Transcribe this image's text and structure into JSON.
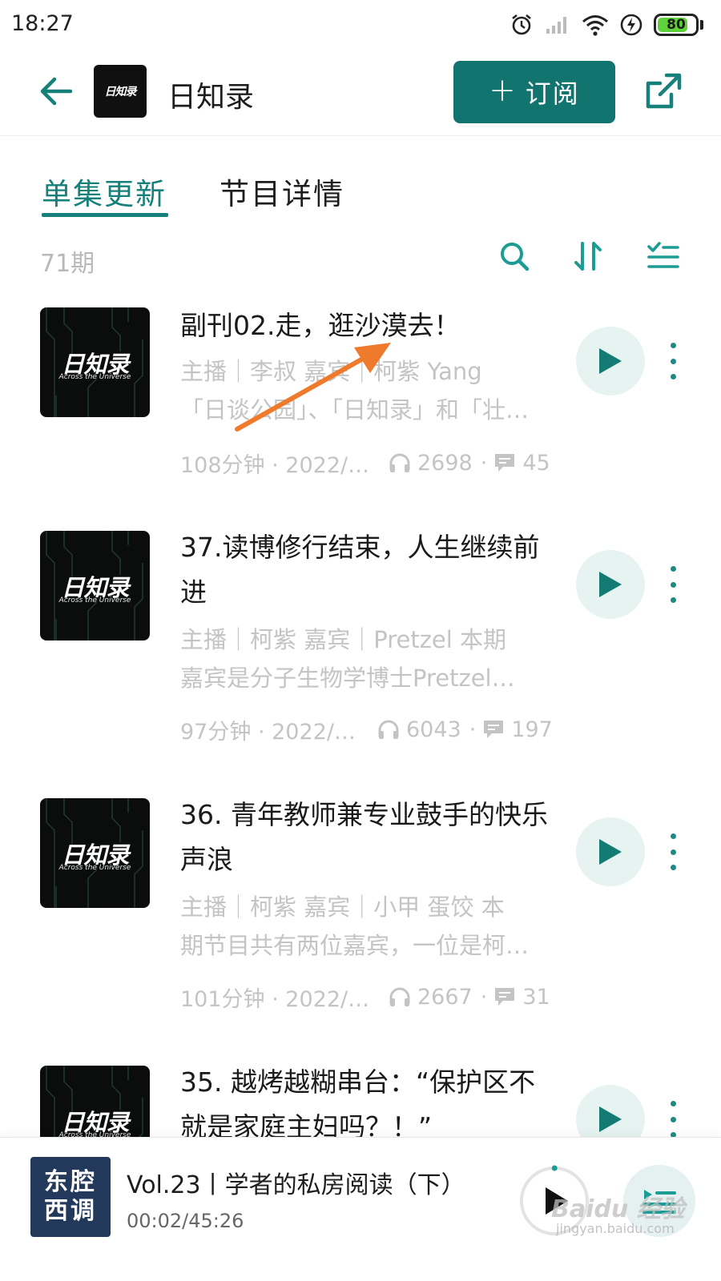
{
  "status_bar": {
    "time": "18:27",
    "battery_level": "80",
    "battery_fraction": 0.8
  },
  "header": {
    "title": "日知录",
    "logo_text": "日知录",
    "subscribe_plus": "+",
    "subscribe_label": "订阅",
    "accent_color": "#12746f"
  },
  "tabs": {
    "active": "单集更新",
    "inactive": "节目详情"
  },
  "toolbar": {
    "episode_count": "71期"
  },
  "cover_art": {
    "title": "日知录",
    "subtitle": "Across the Universe"
  },
  "episodes": [
    {
      "title": "副刊02.走，逛沙漠去！",
      "desc_line1": "主播｜李叔 嘉宾｜柯紫 Yang",
      "desc_line2": "「日谈公园」、「日知录」和「壮…",
      "duration_date": "108分钟 · 2022/…",
      "plays": "2698",
      "comments": "45"
    },
    {
      "title": "37.读博修行结束，人生继续前进",
      "desc_line1": "主播｜柯紫 嘉宾｜Pretzel 本期",
      "desc_line2": "嘉宾是分子生物学博士Pretzel…",
      "duration_date": "97分钟 · 2022/…",
      "plays": "6043",
      "comments": "197"
    },
    {
      "title": "36. 青年教师兼专业鼓手的快乐声浪",
      "desc_line1": "主播｜柯紫 嘉宾｜小甲 蛋饺 本",
      "desc_line2": "期节目共有两位嘉宾，一位是柯…",
      "duration_date": "101分钟 · 2022/…",
      "plays": "2667",
      "comments": "31"
    },
    {
      "title": "35. 越烤越糊串台：“保护区不就是家庭主妇吗？！”"
    }
  ],
  "mini_player": {
    "cover_line1": "东腔",
    "cover_line2": "西调",
    "title": "Vol.23丨学者的私房阅读（下）",
    "time": "00:02/45:26",
    "progress_fraction": 0.001
  },
  "watermark": {
    "text": "Baidu 经验",
    "sub": "jingyan.baidu.com"
  }
}
